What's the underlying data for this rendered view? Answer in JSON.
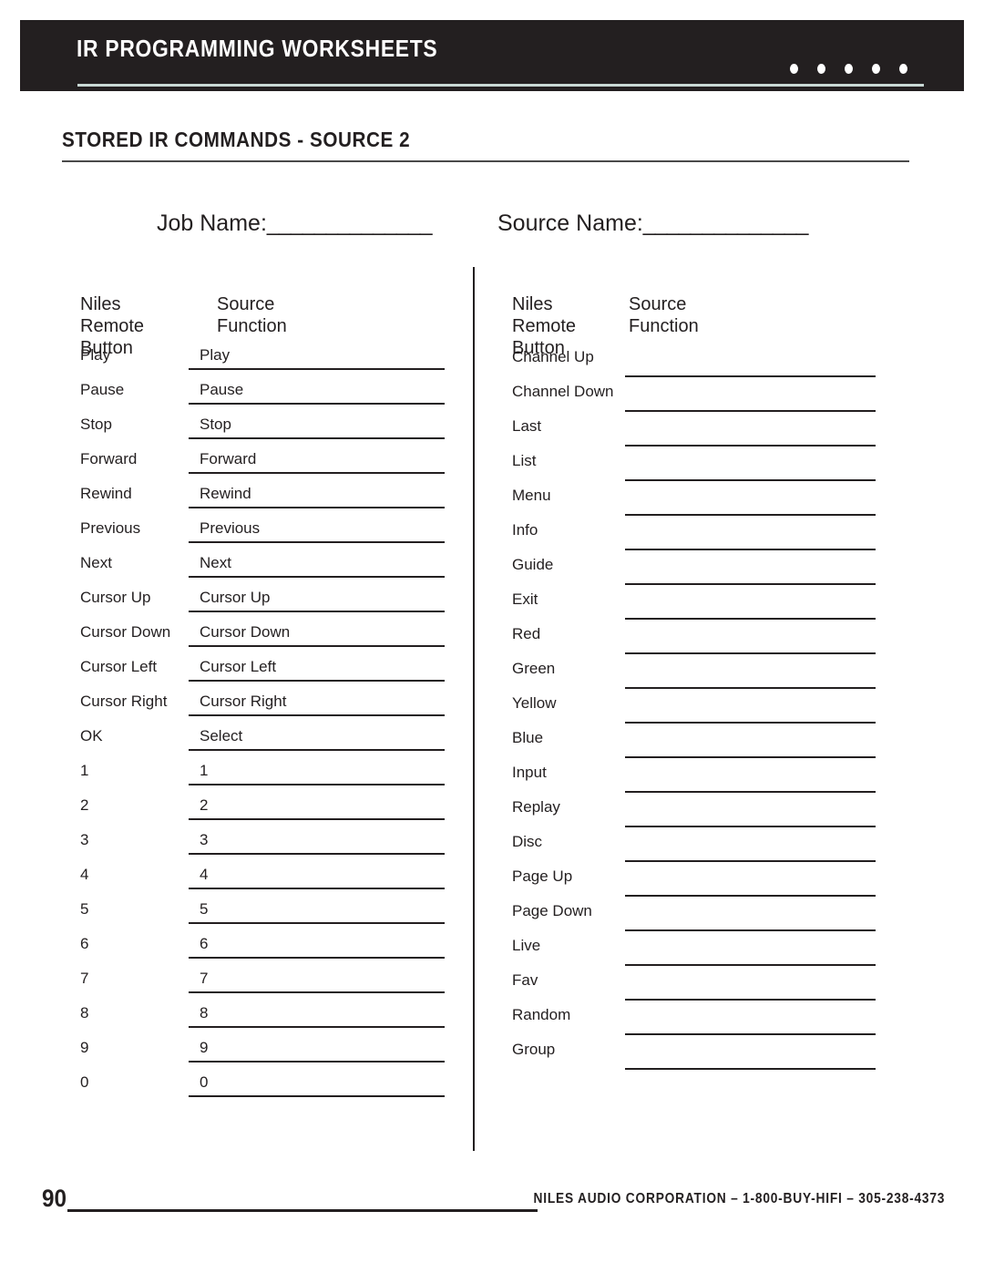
{
  "header": {
    "title": "IR PROGRAMMING WORKSHEETS",
    "dot_count": 5,
    "bar_color": "#231f20",
    "rule_color": "#c9d8d4"
  },
  "section": {
    "title": "STORED IR COMMANDS - SOURCE 2"
  },
  "fields": {
    "job_name": {
      "label": "Job Name:",
      "fill": "______________",
      "value": ""
    },
    "source_name": {
      "label": "Source Name:",
      "fill": "______________",
      "value": ""
    }
  },
  "columns": {
    "left": {
      "header_button": "Niles Remote\nButton",
      "header_function": "Source Function",
      "rows": [
        {
          "button": "Play",
          "function": "Play"
        },
        {
          "button": "Pause",
          "function": "Pause"
        },
        {
          "button": "Stop",
          "function": "Stop"
        },
        {
          "button": "Forward",
          "function": "Forward"
        },
        {
          "button": "Rewind",
          "function": "Rewind"
        },
        {
          "button": "Previous",
          "function": "Previous"
        },
        {
          "button": "Next",
          "function": "Next"
        },
        {
          "button": "Cursor Up",
          "function": "Cursor Up"
        },
        {
          "button": "Cursor Down",
          "function": "Cursor Down"
        },
        {
          "button": "Cursor Left",
          "function": "Cursor Left"
        },
        {
          "button": "Cursor Right",
          "function": "Cursor Right"
        },
        {
          "button": "OK",
          "function": "Select"
        },
        {
          "button": "1",
          "function": "1"
        },
        {
          "button": "2",
          "function": "2"
        },
        {
          "button": "3",
          "function": "3"
        },
        {
          "button": "4",
          "function": "4"
        },
        {
          "button": "5",
          "function": "5"
        },
        {
          "button": "6",
          "function": "6"
        },
        {
          "button": "7",
          "function": "7"
        },
        {
          "button": "8",
          "function": "8"
        },
        {
          "button": "9",
          "function": "9"
        },
        {
          "button": "0",
          "function": "0"
        }
      ]
    },
    "right": {
      "header_button": "Niles Remote\nButton",
      "header_function": "Source Function",
      "rows": [
        {
          "button": "Channel Up",
          "function": ""
        },
        {
          "button": "Channel Down",
          "function": ""
        },
        {
          "button": "Last",
          "function": ""
        },
        {
          "button": "List",
          "function": ""
        },
        {
          "button": "Menu",
          "function": ""
        },
        {
          "button": "Info",
          "function": ""
        },
        {
          "button": "Guide",
          "function": ""
        },
        {
          "button": "Exit",
          "function": ""
        },
        {
          "button": "Red",
          "function": ""
        },
        {
          "button": "Green",
          "function": ""
        },
        {
          "button": "Yellow",
          "function": ""
        },
        {
          "button": "Blue",
          "function": ""
        },
        {
          "button": "Input",
          "function": ""
        },
        {
          "button": "Replay",
          "function": ""
        },
        {
          "button": "Disc",
          "function": ""
        },
        {
          "button": "Page Up",
          "function": ""
        },
        {
          "button": "Page Down",
          "function": ""
        },
        {
          "button": "Live",
          "function": ""
        },
        {
          "button": "Fav",
          "function": ""
        },
        {
          "button": "Random",
          "function": ""
        },
        {
          "button": "Group",
          "function": ""
        }
      ]
    }
  },
  "footer": {
    "page_number": "90",
    "company": "NILES AUDIO CORPORATION – 1-800-BUY-HIFI – 305-238-4373"
  }
}
